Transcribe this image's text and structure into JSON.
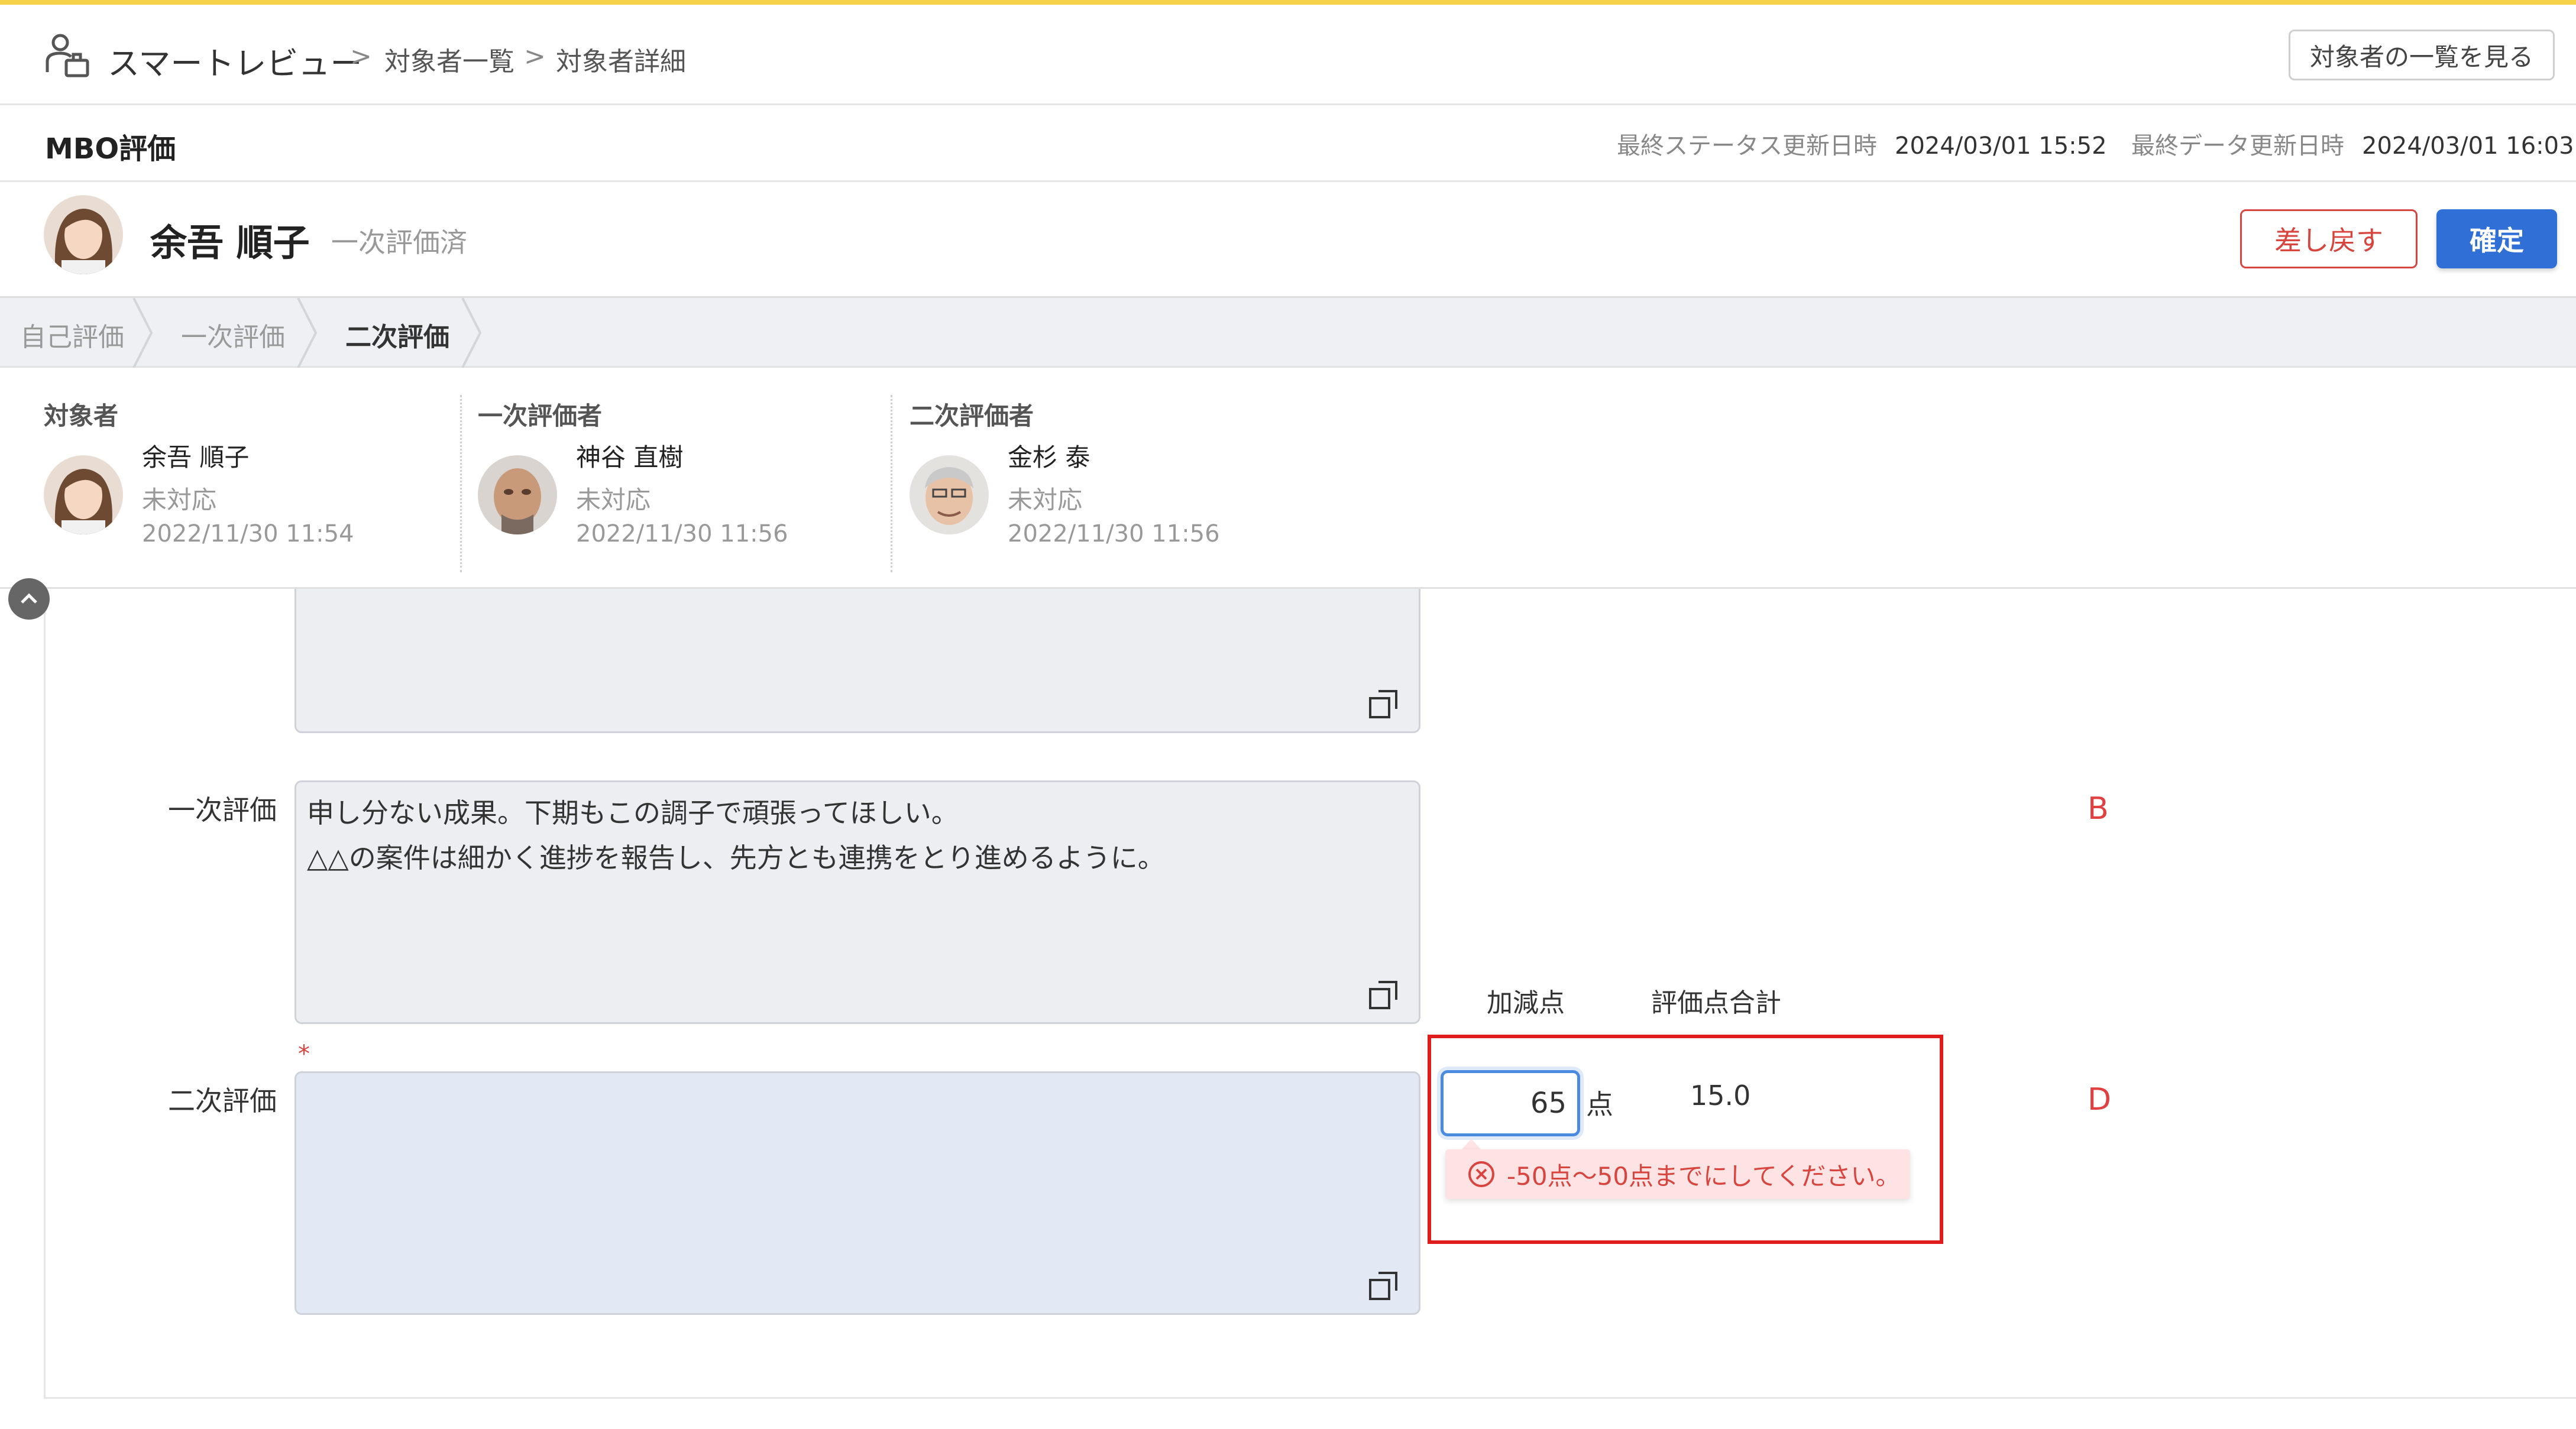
{
  "header": {
    "app_name": "スマートレビュー",
    "breadcrumb": [
      "対象者一覧",
      "対象者詳細"
    ],
    "list_button": "対象者の一覧を見る"
  },
  "subheader": {
    "title": "MBO評価",
    "status_updated_label": "最終ステータス更新日時",
    "status_updated_value": "2024/03/01 15:52",
    "data_updated_label": "最終データ更新日時",
    "data_updated_value": "2024/03/01 16:03"
  },
  "person": {
    "name": "余吾 順子",
    "status": "一次評価済",
    "return_button": "差し戻す",
    "confirm_button": "確定"
  },
  "steps": [
    {
      "label": "自己評価",
      "active": false
    },
    {
      "label": "一次評価",
      "active": false
    },
    {
      "label": "二次評価",
      "active": true
    }
  ],
  "evaluators": [
    {
      "heading": "対象者",
      "name": "余吾 順子",
      "status": "未対応",
      "date": "2022/11/30 11:54"
    },
    {
      "heading": "一次評価者",
      "name": "神谷 直樹",
      "status": "未対応",
      "date": "2022/11/30 11:56"
    },
    {
      "heading": "二次評価者",
      "name": "金杉 泰",
      "status": "未対応",
      "date": "2022/11/30 11:56"
    }
  ],
  "form": {
    "first_eval_label": "一次評価",
    "first_eval_text_line1": "申し分ない成果。下期もこの調子で頑張ってほしい。",
    "first_eval_text_line2": "△△の案件は細かく進捗を報告し、先方とも連携をとり進めるように。",
    "second_eval_label": "二次評価",
    "required_mark": "*",
    "adjust_header": "加減点",
    "total_header": "評価点合計",
    "adjust_value": "65",
    "unit": "点",
    "total_value": "15.0",
    "error_message": "-50点～50点までにしてください。"
  },
  "annotations": {
    "marker_b": "B",
    "marker_d": "D"
  },
  "colors": {
    "accent": "#2f6fd6",
    "danger": "#d8453f",
    "topline": "#f5d24a"
  }
}
